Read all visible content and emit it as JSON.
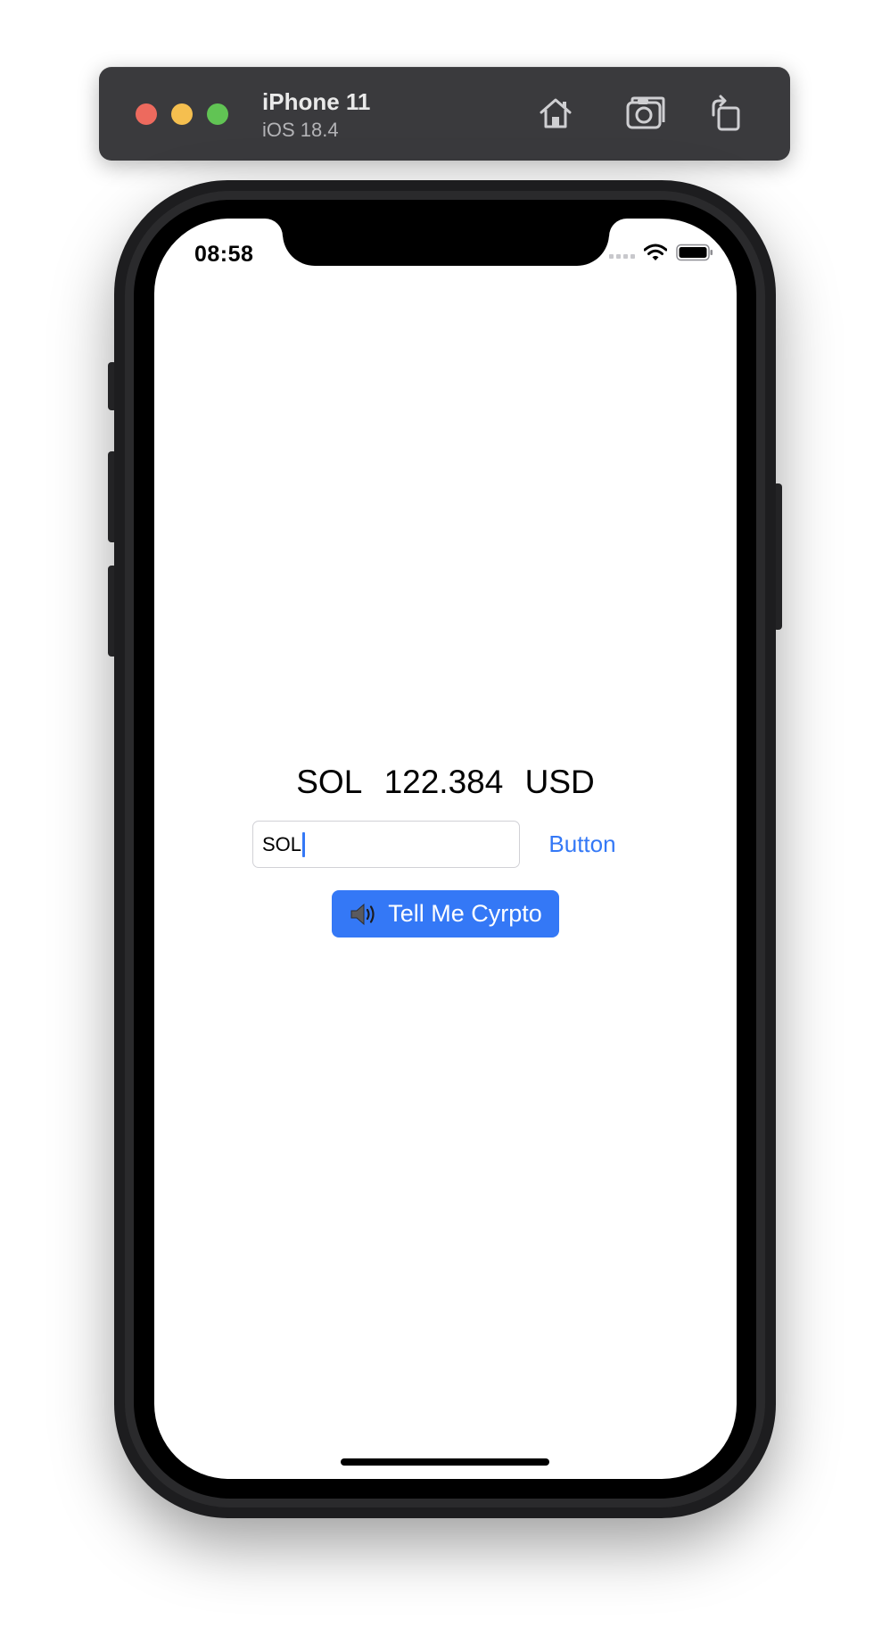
{
  "simulator": {
    "device_name": "iPhone 11",
    "os_version": "iOS 18.4",
    "toolbar_icons": [
      "home-icon",
      "screenshot-icon",
      "rotate-icon"
    ],
    "traffic_light_colors": {
      "close": "#ed6a5e",
      "minimize": "#f5bf4f",
      "zoom": "#61c454"
    }
  },
  "status_bar": {
    "time": "08:58",
    "icons": [
      "cellular-signal-icon",
      "wifi-icon",
      "battery-icon"
    ]
  },
  "app": {
    "price": {
      "symbol": "SOL",
      "value": "122.384",
      "currency": "USD"
    },
    "symbol_input": {
      "value": "SOL"
    },
    "button_label": "Button",
    "speak_button": {
      "label": "Tell Me Cyrpto",
      "icon": "speaker-icon"
    }
  },
  "colors": {
    "accent": "#3478f6",
    "screen_background": "#ffffff",
    "simulator_bar": "#3a3a3d"
  }
}
